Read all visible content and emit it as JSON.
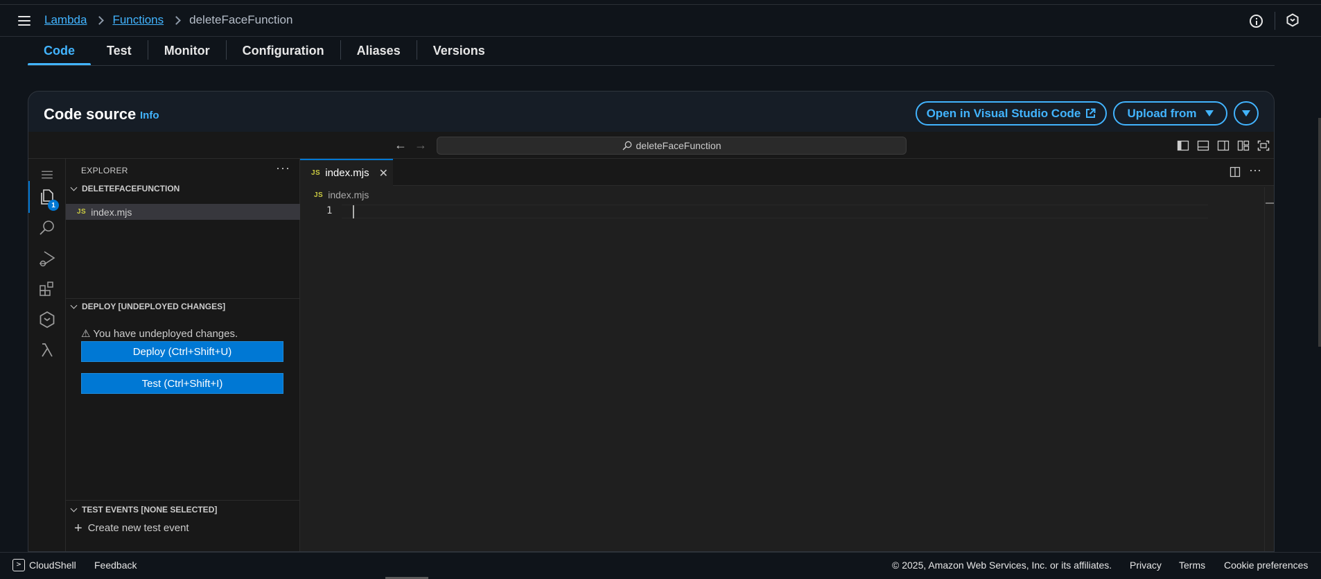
{
  "breadcrumb": {
    "items": [
      {
        "label": "Lambda"
      },
      {
        "label": "Functions"
      }
    ],
    "current": "deleteFaceFunction"
  },
  "tabs": [
    {
      "label": "Code",
      "active": true
    },
    {
      "label": "Test",
      "active": false
    },
    {
      "label": "Monitor",
      "active": false
    },
    {
      "label": "Configuration",
      "active": false
    },
    {
      "label": "Aliases",
      "active": false
    },
    {
      "label": "Versions",
      "active": false
    }
  ],
  "code_source": {
    "title": "Code source",
    "info": "Info",
    "open_vscode_label": "Open in Visual Studio Code",
    "upload_label": "Upload from"
  },
  "ide": {
    "command_center": "deleteFaceFunction",
    "explorer": {
      "header": "EXPLORER",
      "folder": "DELETEFACEFUNCTION",
      "file": "index.mjs",
      "file_badge": "JS",
      "badge_count": "1"
    },
    "deploy": {
      "header": "DEPLOY [UNDEPLOYED CHANGES]",
      "warning": "⚠ You have undeployed changes.",
      "deploy_button": "Deploy (Ctrl+Shift+U)",
      "test_button": "Test (Ctrl+Shift+I)"
    },
    "test_events": {
      "header": "TEST EVENTS [NONE SELECTED]",
      "create": "Create new test event"
    },
    "editor": {
      "tab_label": "index.mjs",
      "tab_badge": "JS",
      "breadcrumb_file": "index.mjs",
      "line_number": "1"
    }
  },
  "footer": {
    "cloudshell": "CloudShell",
    "feedback": "Feedback",
    "copyright": "© 2025, Amazon Web Services, Inc. or its affiliates.",
    "privacy": "Privacy",
    "terms": "Terms",
    "cookies": "Cookie preferences"
  },
  "colors": {
    "accent": "#42b4ff",
    "vscode_blue": "#0078d4",
    "background": "#0f141a"
  }
}
